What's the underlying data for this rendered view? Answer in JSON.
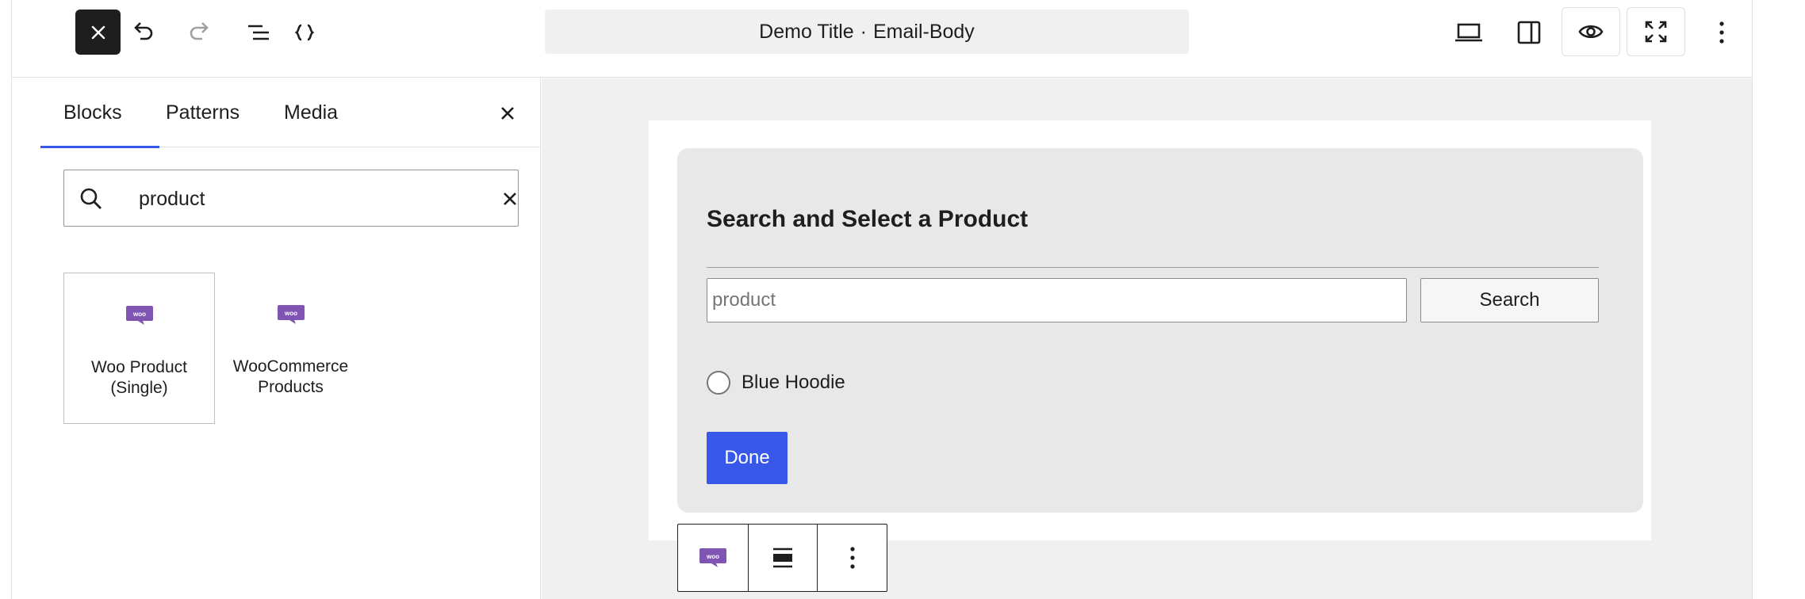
{
  "header": {
    "title": "Demo Title",
    "separator": "·",
    "subtitle": "Email-Body",
    "icons": [
      "close-icon",
      "undo-icon",
      "redo-icon",
      "list-view-icon",
      "code-braces-icon",
      "desktop-icon",
      "sidebar-icon",
      "preview-eye-icon",
      "fullscreen-icon",
      "more-vertical-icon"
    ]
  },
  "sidebar": {
    "tabs": [
      {
        "label": "Blocks",
        "active": true
      },
      {
        "label": "Patterns",
        "active": false
      },
      {
        "label": "Media",
        "active": false
      }
    ],
    "search": {
      "value": "product",
      "placeholder": "Search"
    },
    "results": [
      {
        "label": "Woo Product (Single)",
        "icon": "woo-icon",
        "selected": true
      },
      {
        "label": "WooCommerce Products",
        "icon": "woo-icon",
        "selected": false
      }
    ]
  },
  "canvas": {
    "card_title": "Search and Select a Product",
    "search_input_value": "product",
    "search_button_label": "Search",
    "options": [
      {
        "label": "Blue Hoodie",
        "checked": false
      }
    ],
    "done_label": "Done"
  },
  "block_toolbar": {
    "icons": [
      "woo-icon",
      "align-icon",
      "more-vertical-icon"
    ]
  },
  "colors": {
    "accent": "#3858e9",
    "woo_purple": "#7f54b3",
    "dark": "#1e1e1e"
  }
}
